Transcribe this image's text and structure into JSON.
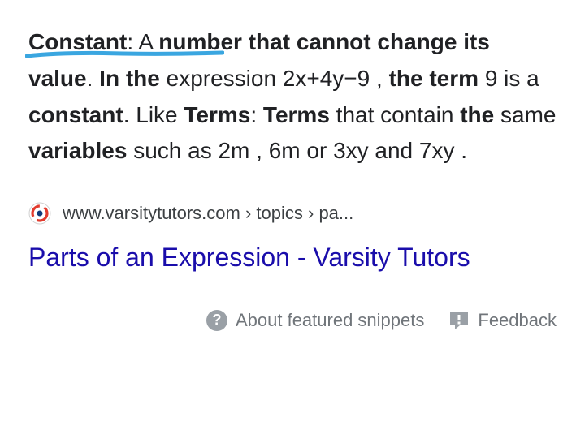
{
  "snippet": {
    "w1": "Constant",
    "w2": ": A ",
    "w3": "number that cannot change its value",
    "w4": ". ",
    "w5": "In the",
    "w6": " expression 2x+4y−9 , ",
    "w7": "the term",
    "w8": " 9 is a ",
    "w9": "constant",
    "w10": ". Like ",
    "w11": "Terms",
    "w12": ": ",
    "w13": "Terms",
    "w14": " that contain ",
    "w15": "the",
    "w16": " same ",
    "w17": "variables",
    "w18": " such as 2m , 6m or 3xy and 7xy ."
  },
  "source": {
    "breadcrumb_domain": "www.varsitytutors.com",
    "breadcrumb_sep1": " › ",
    "breadcrumb_part1": "topics",
    "breadcrumb_sep2": " › ",
    "breadcrumb_part2": "pa...",
    "title": "Parts of an Expression - Varsity Tutors"
  },
  "footer": {
    "about_label": "About featured snippets",
    "feedback_label": "Feedback",
    "help_glyph": "?"
  },
  "colors": {
    "annotation": "#3aa6e0",
    "link": "#1a0dab",
    "text": "#202124",
    "muted": "#70757a"
  }
}
